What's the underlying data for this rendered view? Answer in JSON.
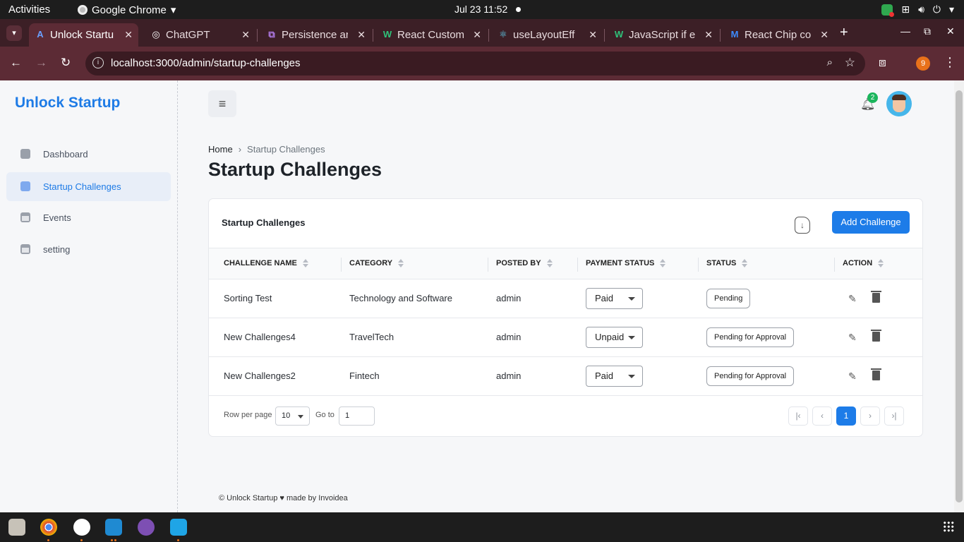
{
  "os": {
    "activities": "Activities",
    "app_name": "Google Chrome",
    "clock": "Jul 23  11:52"
  },
  "browser": {
    "tabs": [
      {
        "title": "Unlock Startu",
        "icon": "A"
      },
      {
        "title": "ChatGPT",
        "icon": "◎"
      },
      {
        "title": "Persistence ar",
        "icon": "⧉"
      },
      {
        "title": "React Custom",
        "icon": "W"
      },
      {
        "title": "useLayoutEff",
        "icon": "⚛"
      },
      {
        "title": "JavaScript if e",
        "icon": "W"
      },
      {
        "title": "React Chip co",
        "icon": "M"
      }
    ],
    "url": "localhost:3000/admin/startup-challenges",
    "profile_initial": "9"
  },
  "sidebar": {
    "brand": "Unlock Startup",
    "items": [
      {
        "label": "Dashboard",
        "icon": "dashboard-icon"
      },
      {
        "label": "Startup Challenges",
        "icon": "challenges-icon"
      },
      {
        "label": "Events",
        "icon": "calendar-icon"
      },
      {
        "label": "setting",
        "icon": "calendar-icon"
      }
    ]
  },
  "header": {
    "notification_count": "2"
  },
  "breadcrumb": {
    "home": "Home",
    "current": "Startup Challenges"
  },
  "page": {
    "title": "Startup Challenges"
  },
  "card": {
    "title": "Startup Challenges",
    "add_button": "Add Challenge"
  },
  "table": {
    "columns": [
      "CHALLENGE NAME",
      "CATEGORY",
      "POSTED BY",
      "PAYMENT STATUS",
      "STATUS",
      "ACTION"
    ],
    "rows": [
      {
        "name": "Sorting Test",
        "category": "Technology and Software",
        "posted_by": "admin",
        "payment": "Paid",
        "status": "Pending"
      },
      {
        "name": "New Challenges4",
        "category": "TravelTech",
        "posted_by": "admin",
        "payment": "Unpaid",
        "status": "Pending for Approval"
      },
      {
        "name": "New Challenges2",
        "category": "Fintech",
        "posted_by": "admin",
        "payment": "Paid",
        "status": "Pending for Approval"
      }
    ]
  },
  "pagination": {
    "rows_per_page_label": "Row per page",
    "rows_per_page": "10",
    "goto_label": "Go to",
    "goto_value": "1",
    "current_page": "1"
  },
  "footer": {
    "text": "© Unlock Startup ♥ made by Invoidea"
  },
  "colors": {
    "accent": "#1d7ce8",
    "badge": "#1bb55c"
  }
}
